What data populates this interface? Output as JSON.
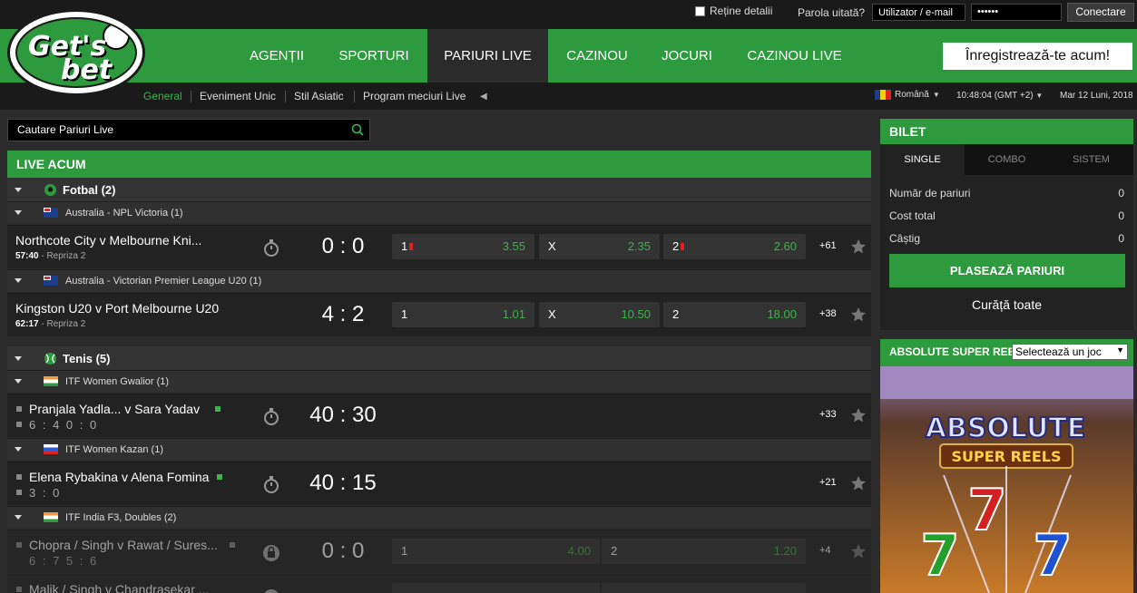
{
  "topbar": {
    "remember_label": "Reține detalii",
    "forgot_label": "Parola uitată?",
    "username_placeholder": "Utilizator / e-mail",
    "password_value": "••••••",
    "login_label": "Conectare"
  },
  "logo": {
    "text_line1": "Get's",
    "text_line2": "bet"
  },
  "nav": {
    "items": [
      {
        "label": "AGENȚII"
      },
      {
        "label": "SPORTURI"
      },
      {
        "label": "PARIURI LIVE"
      },
      {
        "label": "CAZINOU"
      },
      {
        "label": "JOCURI"
      },
      {
        "label": "CAZINOU LIVE"
      }
    ],
    "active": "PARIURI LIVE",
    "register_label": "Înregistrează-te acum!"
  },
  "subnav": {
    "items": [
      {
        "label": "General"
      },
      {
        "label": "Eveniment Unic"
      },
      {
        "label": "Stil Asiatic"
      },
      {
        "label": "Program meciuri Live"
      }
    ],
    "language": "Română",
    "time": "10:48:04 (GMT +2)",
    "date": "Mar 12 Luni, 2018"
  },
  "search": {
    "placeholder": "Cautare Pariuri Live"
  },
  "live": {
    "title": "LIVE ACUM",
    "football": {
      "label": "Fotbal (2)",
      "leagues": [
        {
          "name": "Australia - NPL Victoria (1)",
          "match": {
            "teams": "Northcote City  v  Melbourne Kni...",
            "clock": "57:40",
            "period": " - Repriza 2",
            "score": "0 : 0",
            "odds": [
              {
                "label": "1",
                "value": "3.55"
              },
              {
                "label": "X",
                "value": "2.35"
              },
              {
                "label": "2",
                "value": "2.60"
              }
            ],
            "more": "+61"
          }
        },
        {
          "name": "Australia - Victorian Premier League U20 (1)",
          "match": {
            "teams": "Kingston U20  v  Port Melbourne U20",
            "clock": "62:17",
            "period": " - Repriza 2",
            "score": "4 : 2",
            "odds": [
              {
                "label": "1",
                "value": "1.01"
              },
              {
                "label": "X",
                "value": "10.50"
              },
              {
                "label": "2",
                "value": "18.00"
              }
            ],
            "more": "+38"
          }
        }
      ]
    },
    "tennis": {
      "label": "Tenis (5)",
      "leagues": [
        {
          "name": "ITF Women Gwalior (1)",
          "match": {
            "teams": "Pranjala Yadla...    v  Sara Yadav",
            "sets": "6 : 4   0 : 0",
            "score": "40 : 30",
            "more": "+33"
          }
        },
        {
          "name": "ITF Women Kazan (1)",
          "match": {
            "teams": "Elena Rybakina  v  Alena Fomina",
            "sets": "3 : 0",
            "score": "40 : 15",
            "more": "+21"
          }
        },
        {
          "name": "ITF India F3, Doubles (2)",
          "match": {
            "teams": "Chopra / Singh  v  Rawat / Sures...",
            "sets": "6 : 7   5 : 6",
            "score": "0 : 0",
            "odds": [
              {
                "label": "1",
                "value": "4.00"
              },
              {
                "label": "2",
                "value": "1.20"
              }
            ],
            "more": "+4"
          },
          "match2": {
            "teams": "Malik / Singh  v  Chandrasekar ..."
          }
        }
      ]
    }
  },
  "betslip": {
    "title": "BILET",
    "tabs": [
      "SINGLE",
      "COMBO",
      "SISTEM"
    ],
    "rows": [
      {
        "label": "Număr de pariuri",
        "value": "0"
      },
      {
        "label": "Cost total",
        "value": "0"
      },
      {
        "label": "Câștig",
        "value": "0"
      }
    ],
    "place_label": "PLASEAZĂ PARIURI",
    "clear_label": "Curăță toate"
  },
  "promo": {
    "title": "ABSOLUTE SUPER REE",
    "select_value": "Selectează un joc",
    "game_title_line1": "ABSOLUTE",
    "game_title_line2": "SUPER REELS"
  },
  "colors": {
    "brand_green": "#2d9a3e",
    "odd_green": "#3cb44b",
    "dark_bg": "#2b2b2b"
  },
  "icons": [
    "search-icon",
    "timer-icon",
    "lock-icon",
    "star-icon",
    "football-icon",
    "tennis-icon",
    "speaker-icon"
  ]
}
